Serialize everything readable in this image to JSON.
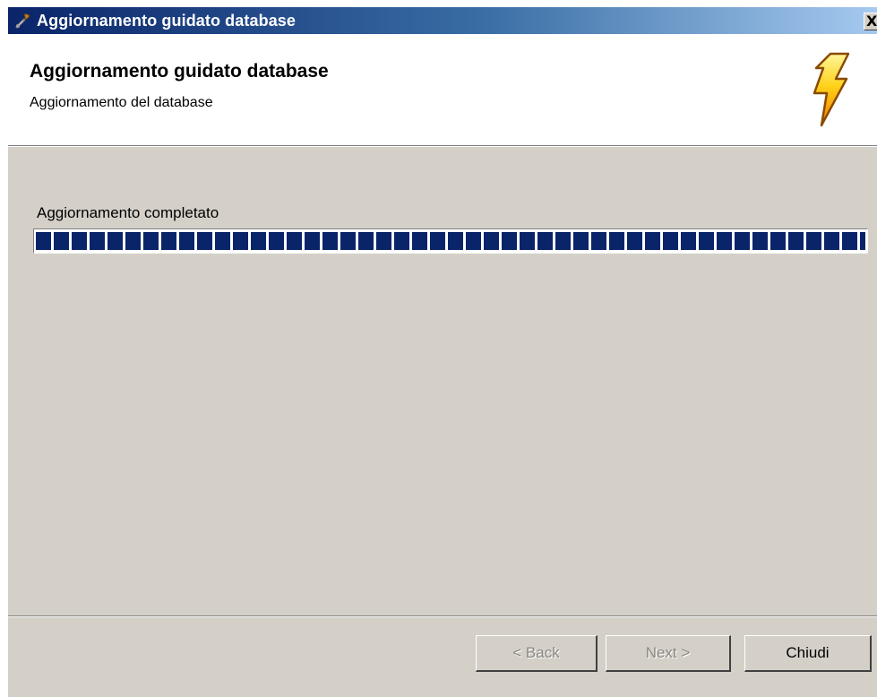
{
  "window": {
    "title": "Aggiornamento guidato database",
    "title_icon": "wrench-icon",
    "close_label": "X"
  },
  "header": {
    "title": "Aggiornamento guidato database",
    "subtitle": "Aggiornamento del database",
    "icon": "lightning-bolt-icon"
  },
  "progress": {
    "status_text": "Aggiornamento completato",
    "fraction": 1.0,
    "color": "#0a246a"
  },
  "buttons": {
    "back_label": "< Back",
    "next_label": "Next >",
    "close_label": "Chiudi"
  },
  "colors": {
    "titlebar_start": "#0a246a",
    "titlebar_end": "#a6caf0",
    "dialog_bg": "#d4d0c8",
    "header_bg": "#ffffff"
  }
}
